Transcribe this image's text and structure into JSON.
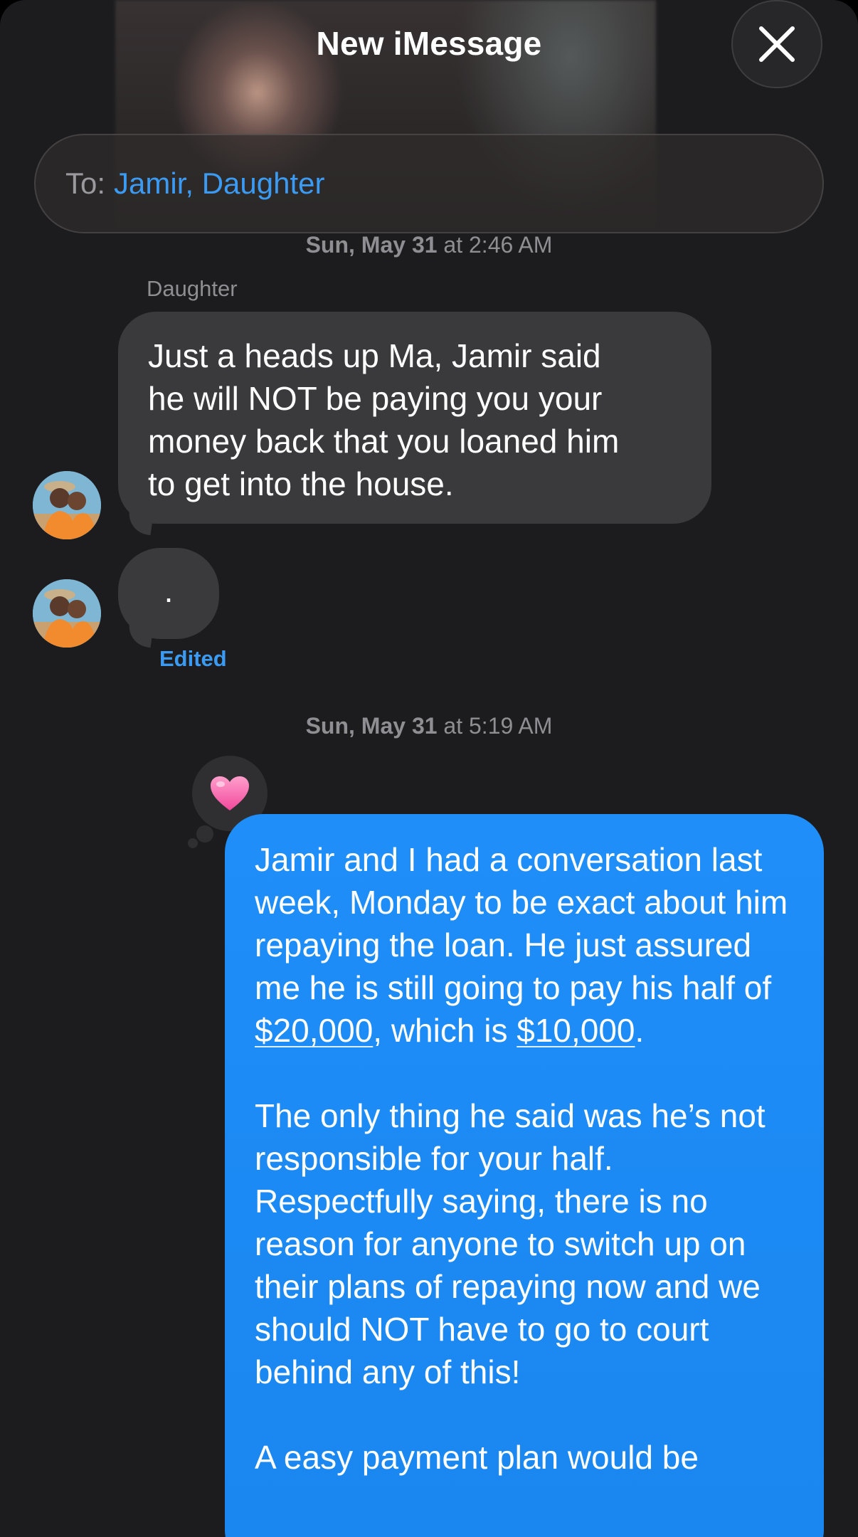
{
  "header": {
    "title": "New iMessage",
    "close_icon": "close-icon"
  },
  "recipients": {
    "label": "To:",
    "value": "Jamir, Daughter"
  },
  "conversation": {
    "timestamp1": {
      "day": "Sun, May 31",
      "time": "at 2:46 AM"
    },
    "sender_name": "Daughter",
    "incoming_message": "Just a heads up Ma, Jamir said\nhe will NOT be paying you your\nmoney back that you loaned him\nto get into the house.",
    "incoming_message_2": ".",
    "edited_label": "Edited",
    "timestamp2": {
      "day": "Sun, May 31",
      "time": "at 5:19 AM"
    },
    "reaction": "heart-emoji",
    "outgoing": {
      "p1_a": "Jamir and I had a conversation last week, Monday to be exact about him repaying the loan. He just assured me he is still going to pay his half of ",
      "p1_link1": "$20,000",
      "p1_b": ", which is ",
      "p1_link2": "$10,000",
      "p1_c": ".",
      "p2": "The only thing he said was he’s not responsible for your half. Respectfully saying, there is no reason for anyone to switch up on their plans of repaying now and we should NOT have to go to court behind any of this!",
      "p3": "A easy payment plan would be"
    }
  },
  "colors": {
    "background": "#1c1c1e",
    "incoming_bubble": "#3a3a3c",
    "outgoing_bubble": "#1f8ef8",
    "accent": "#3b9bf3"
  }
}
